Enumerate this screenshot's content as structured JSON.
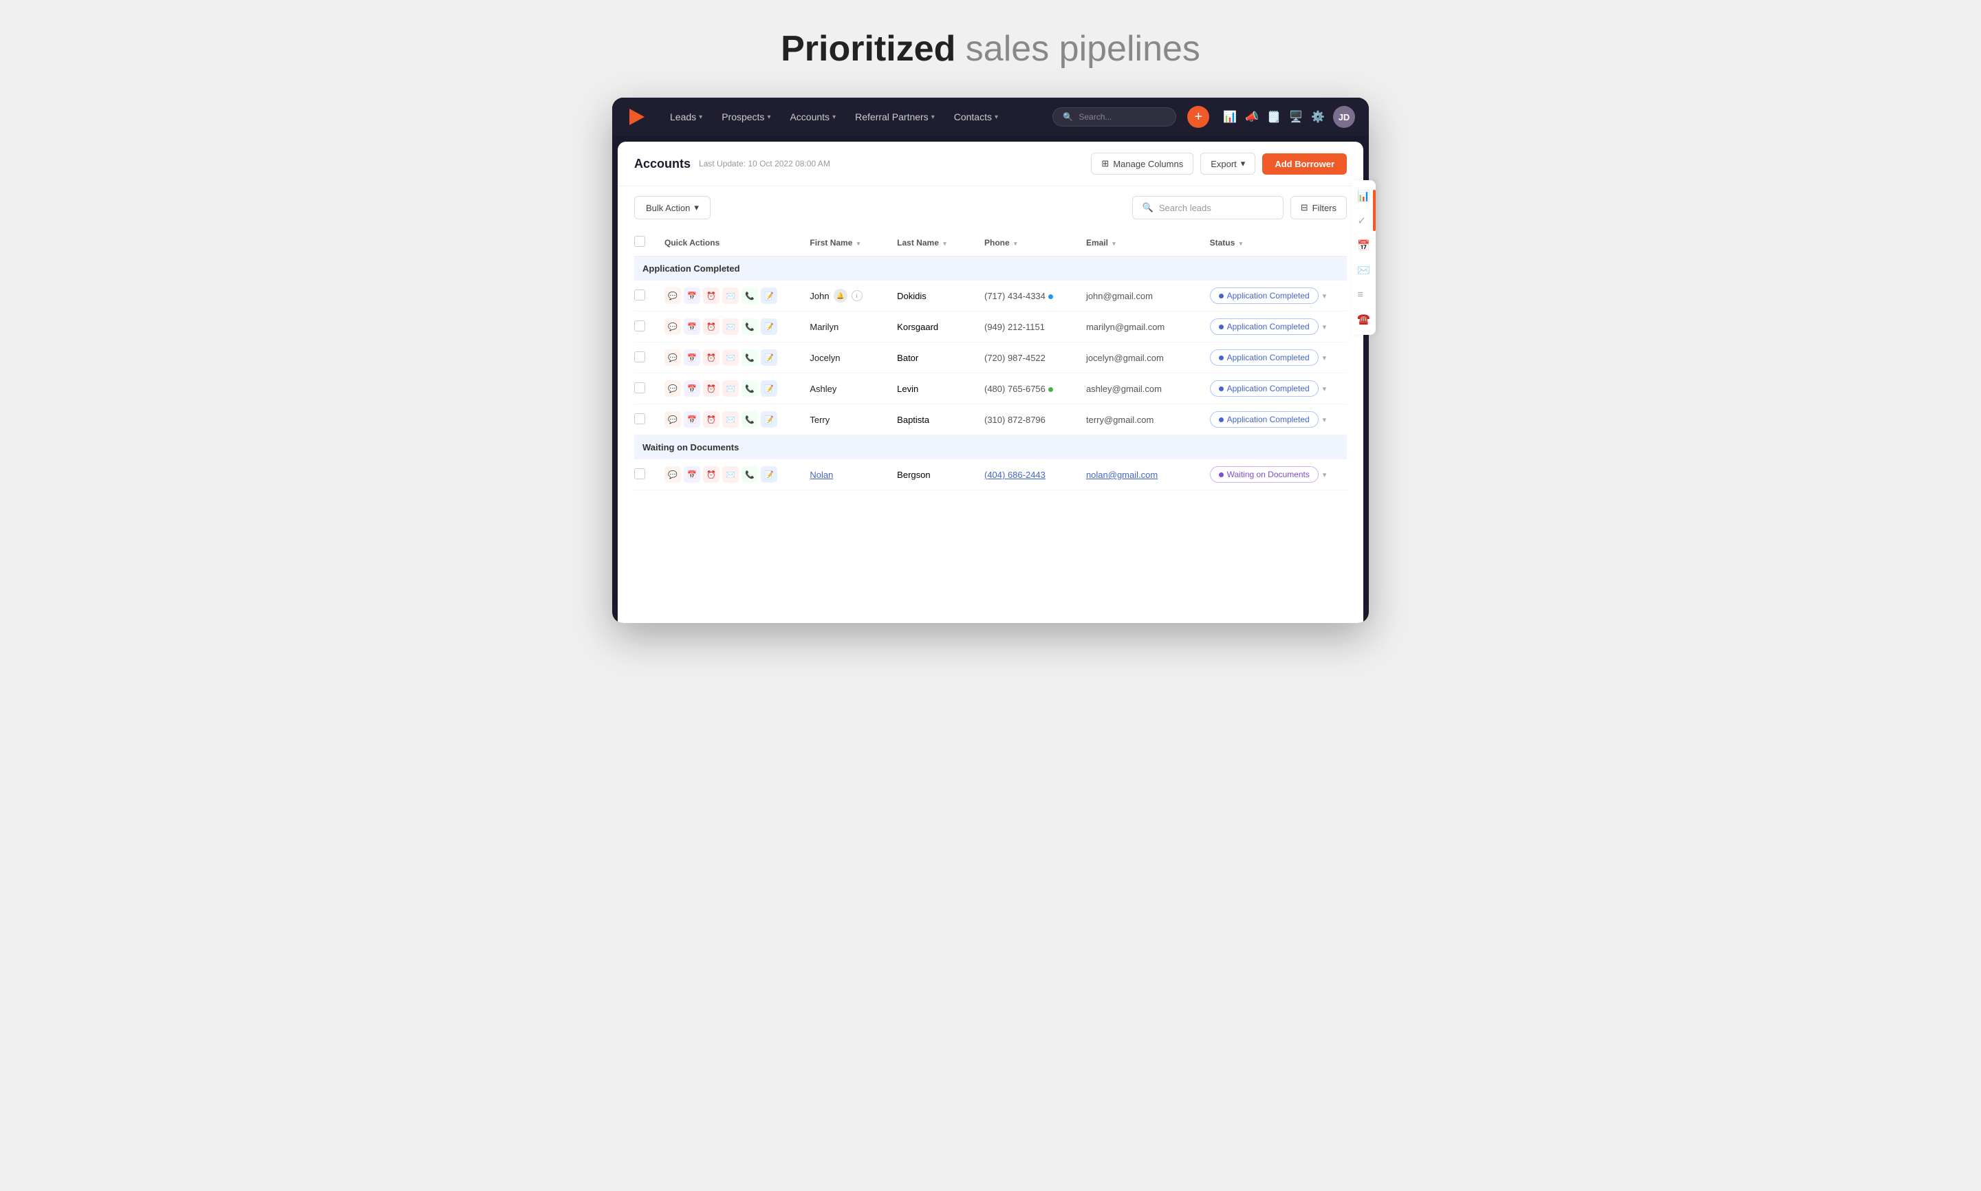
{
  "hero": {
    "title_bold": "Prioritized",
    "title_normal": " sales pipelines"
  },
  "nav": {
    "items": [
      {
        "label": "Leads",
        "has_dropdown": true
      },
      {
        "label": "Prospects",
        "has_dropdown": true
      },
      {
        "label": "Accounts",
        "has_dropdown": true
      },
      {
        "label": "Referral Partners",
        "has_dropdown": true
      },
      {
        "label": "Contacts",
        "has_dropdown": true
      }
    ],
    "search_placeholder": "Search...",
    "add_button_label": "+",
    "icons": [
      "📊",
      "📣",
      "🗒️",
      "🖥️",
      "⚙️"
    ]
  },
  "page": {
    "title": "Accounts",
    "last_update": "Last Update: 10 Oct 2022 08:00 AM",
    "manage_columns_label": "Manage Columns",
    "export_label": "Export",
    "add_borrower_label": "Add Borrower"
  },
  "toolbar": {
    "bulk_action_label": "Bulk Action",
    "search_placeholder": "Search leads",
    "filters_label": "Filters"
  },
  "table": {
    "columns": [
      {
        "key": "checkbox",
        "label": ""
      },
      {
        "key": "actions",
        "label": "Quick Actions"
      },
      {
        "key": "first_name",
        "label": "First Name",
        "sortable": true
      },
      {
        "key": "last_name",
        "label": "Last Name",
        "sortable": true
      },
      {
        "key": "phone",
        "label": "Phone",
        "sortable": true
      },
      {
        "key": "email",
        "label": "Email",
        "sortable": true
      },
      {
        "key": "status",
        "label": "Status",
        "sortable": true
      }
    ],
    "groups": [
      {
        "name": "Application Completed",
        "rows": [
          {
            "first_name": "John",
            "last_name": "Dokidis",
            "phone": "(717) 434-4334",
            "phone_dot": "blue",
            "email": "john@gmail.com",
            "status": "Application Completed",
            "status_type": "completed",
            "is_link": false
          },
          {
            "first_name": "Marilyn",
            "last_name": "Korsgaard",
            "phone": "(949) 212-1151",
            "phone_dot": null,
            "email": "marilyn@gmail.com",
            "status": "Application Completed",
            "status_type": "completed",
            "is_link": false
          },
          {
            "first_name": "Jocelyn",
            "last_name": "Bator",
            "phone": "(720) 987-4522",
            "phone_dot": null,
            "email": "jocelyn@gmail.com",
            "status": "Application Completed",
            "status_type": "completed",
            "is_link": false
          },
          {
            "first_name": "Ashley",
            "last_name": "Levin",
            "phone": "(480) 765-6756",
            "phone_dot": "green",
            "email": "ashley@gmail.com",
            "status": "Application Completed",
            "status_type": "completed",
            "is_link": false
          },
          {
            "first_name": "Terry",
            "last_name": "Baptista",
            "phone": "(310) 872-8796",
            "phone_dot": null,
            "email": "terry@gmail.com",
            "status": "Application Completed",
            "status_type": "completed",
            "is_link": false
          }
        ]
      },
      {
        "name": "Waiting on Documents",
        "rows": [
          {
            "first_name": "Nolan",
            "last_name": "Bergson",
            "phone": "(404) 686-2443",
            "phone_dot": null,
            "email": "nolan@gmail.com",
            "status": "Waiting on Documents",
            "status_type": "waiting",
            "is_link": true
          }
        ]
      }
    ]
  },
  "side_panel_icons": [
    "📊",
    "✓",
    "📅",
    "✉️",
    "≡",
    "☎️"
  ]
}
